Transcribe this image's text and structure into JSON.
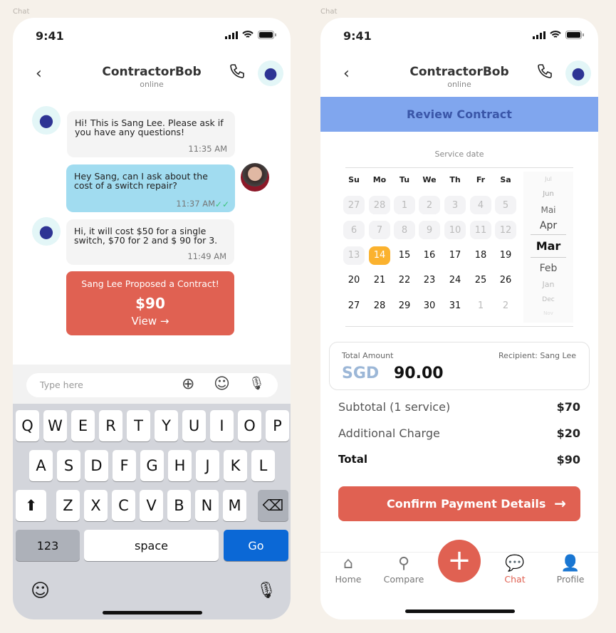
{
  "screen_labels": [
    "Chat",
    "Chat"
  ],
  "status": {
    "time": "9:41"
  },
  "chat": {
    "contact_name": "ContractorBob",
    "contact_status": "online",
    "messages": [
      {
        "from": "contractor",
        "text": "Hi! This is Sang Lee. Please ask if you have any questions!",
        "time": "11:35 AM"
      },
      {
        "from": "user",
        "text": "Hey Sang, can I ask about the cost of a switch repair?",
        "time": "11:37 AM",
        "read": true
      },
      {
        "from": "contractor",
        "text": "Hi, it will cost $50 for a single switch, $70 for 2 and $ 90 for 3.",
        "time": "11:49 AM"
      }
    ],
    "proposal": {
      "title": "Sang Lee Proposed a Contract!",
      "amount": "$90",
      "view_label": "View"
    },
    "input_placeholder": "Type here",
    "keyboard": {
      "rows": [
        [
          "Q",
          "W",
          "E",
          "R",
          "T",
          "Y",
          "U",
          "I",
          "O",
          "P"
        ],
        [
          "A",
          "S",
          "D",
          "F",
          "G",
          "H",
          "J",
          "K",
          "L"
        ],
        [
          "Z",
          "X",
          "C",
          "V",
          "B",
          "N",
          "M"
        ]
      ],
      "numbers": "123",
      "space": "space",
      "go": "Go"
    }
  },
  "contract": {
    "contact_name": "ContractorBob",
    "contact_status": "online",
    "banner": "Review Contract",
    "service_date_label": "Service date",
    "weekdays": [
      "Su",
      "Mo",
      "Tu",
      "We",
      "Th",
      "Fr",
      "Sa"
    ],
    "days": [
      [
        "27",
        "28",
        "1",
        "2",
        "3",
        "4",
        "5"
      ],
      [
        "6",
        "7",
        "8",
        "9",
        "10",
        "11",
        "12"
      ],
      [
        "13",
        "14",
        "15",
        "16",
        "17",
        "18",
        "19"
      ],
      [
        "20",
        "21",
        "22",
        "23",
        "24",
        "25",
        "26"
      ],
      [
        "27",
        "28",
        "29",
        "30",
        "31",
        "1",
        "2"
      ]
    ],
    "selected_day": "14",
    "months": [
      "Jul",
      "Jun",
      "Mai",
      "Apr",
      "Mar",
      "Feb",
      "Jan",
      "Dec",
      "Nov"
    ],
    "selected_month": "Mar",
    "total_label": "Total Amount",
    "recipient": "Recipient: Sang Lee",
    "currency": "SGD",
    "total_amount": "90.00",
    "lines": [
      {
        "label": "Subtotal (1 service)",
        "value": "$70"
      },
      {
        "label": "Additional Charge",
        "value": "$20"
      },
      {
        "label": "Total",
        "value": "$90"
      }
    ],
    "confirm_label": "Confirm Payment Details",
    "tabs": [
      {
        "label": "Home",
        "icon": "home-icon"
      },
      {
        "label": "Compare",
        "icon": "compare-icon"
      },
      {
        "label": "Chat",
        "icon": "chat-icon",
        "active": true
      },
      {
        "label": "Profile",
        "icon": "profile-icon"
      }
    ]
  },
  "colors": {
    "accent": "#e06152",
    "banner": "#80a6ee",
    "user_bubble": "#a1dcf0",
    "selected_day": "#fbb22e",
    "go": "#0b68d6"
  }
}
